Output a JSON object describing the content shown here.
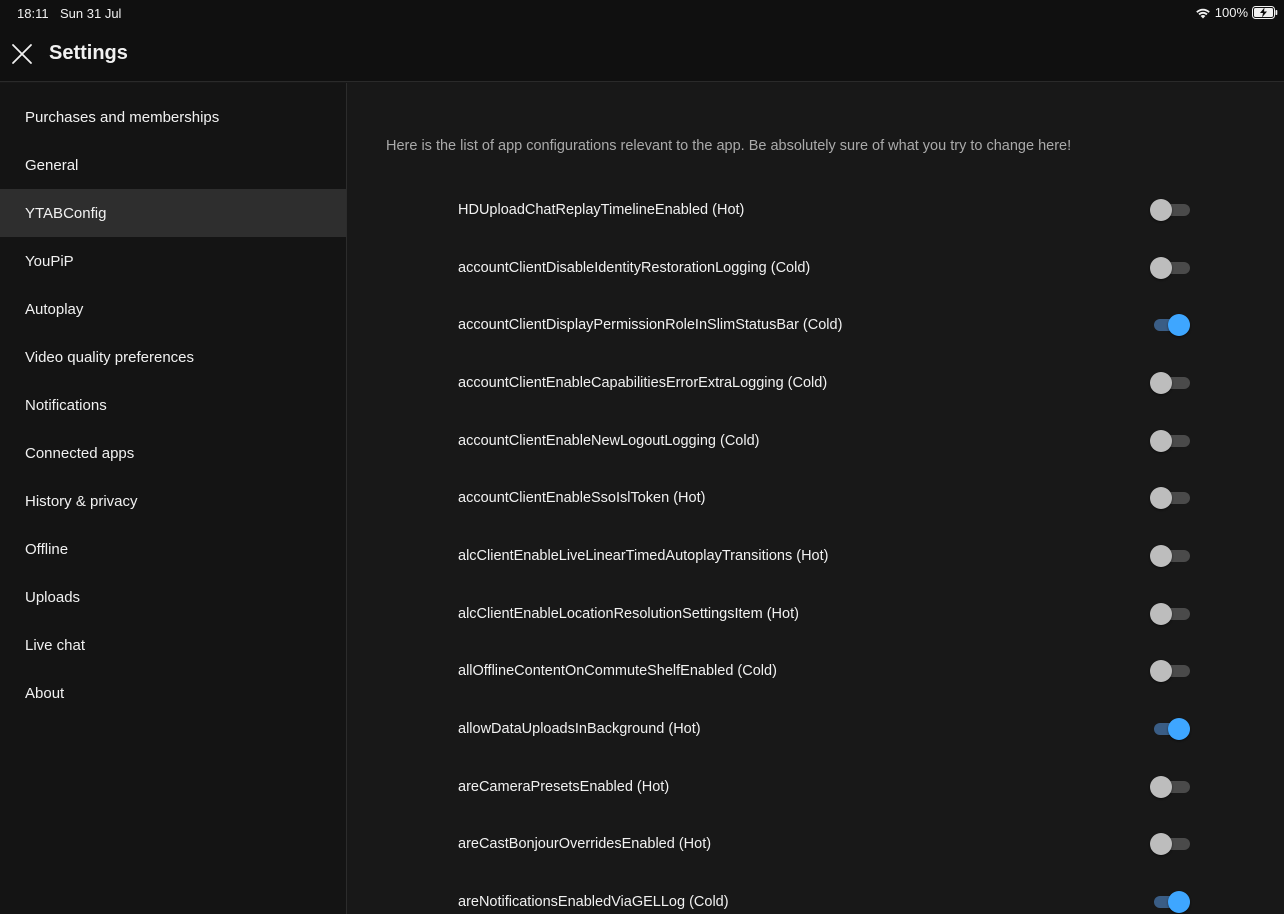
{
  "status_bar": {
    "time": "18:11",
    "date": "Sun 31 Jul",
    "battery": "100%"
  },
  "header": {
    "title": "Settings",
    "close_icon": "close-icon"
  },
  "sidebar": {
    "items": [
      {
        "label": "Purchases and memberships",
        "active": false
      },
      {
        "label": "General",
        "active": false
      },
      {
        "label": "YTABConfig",
        "active": true
      },
      {
        "label": "YouPiP",
        "active": false
      },
      {
        "label": "Autoplay",
        "active": false
      },
      {
        "label": "Video quality preferences",
        "active": false
      },
      {
        "label": "Notifications",
        "active": false
      },
      {
        "label": "Connected apps",
        "active": false
      },
      {
        "label": "History & privacy",
        "active": false
      },
      {
        "label": "Offline",
        "active": false
      },
      {
        "label": "Uploads",
        "active": false
      },
      {
        "label": "Live chat",
        "active": false
      },
      {
        "label": "About",
        "active": false
      }
    ]
  },
  "main": {
    "intro": "Here is the list of app configurations relevant to the app. Be absolutely sure of what you try to change here!",
    "configs": [
      {
        "label": "HDUploadChatReplayTimelineEnabled (Hot)",
        "enabled": false
      },
      {
        "label": "accountClientDisableIdentityRestorationLogging (Cold)",
        "enabled": false
      },
      {
        "label": "accountClientDisplayPermissionRoleInSlimStatusBar (Cold)",
        "enabled": true
      },
      {
        "label": "accountClientEnableCapabilitiesErrorExtraLogging (Cold)",
        "enabled": false
      },
      {
        "label": "accountClientEnableNewLogoutLogging (Cold)",
        "enabled": false
      },
      {
        "label": "accountClientEnableSsoIslToken (Hot)",
        "enabled": false
      },
      {
        "label": "alcClientEnableLiveLinearTimedAutoplayTransitions (Hot)",
        "enabled": false
      },
      {
        "label": "alcClientEnableLocationResolutionSettingsItem (Hot)",
        "enabled": false
      },
      {
        "label": "allOfflineContentOnCommuteShelfEnabled (Cold)",
        "enabled": false
      },
      {
        "label": "allowDataUploadsInBackground (Hot)",
        "enabled": true
      },
      {
        "label": "areCameraPresetsEnabled (Hot)",
        "enabled": false
      },
      {
        "label": "areCastBonjourOverridesEnabled (Hot)",
        "enabled": false
      },
      {
        "label": "areNotificationsEnabledViaGELLog (Cold)",
        "enabled": true
      }
    ]
  },
  "colors": {
    "background": "#181818",
    "sidebar_active": "#2e2e2e",
    "toggle_on": "#3ea6ff",
    "toggle_off": "#bdbdbd"
  }
}
